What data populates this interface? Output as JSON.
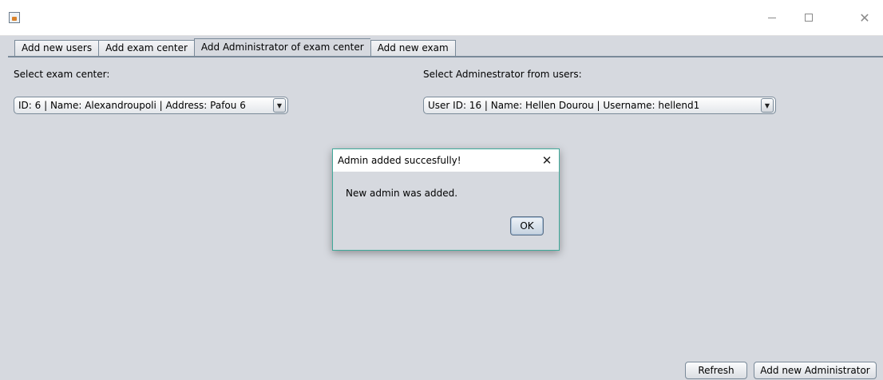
{
  "window": {
    "title": "",
    "minimize_glyph": "—",
    "maximize_glyph": "☐",
    "close_glyph": "✕"
  },
  "tabs": [
    {
      "label": "Add new users",
      "active": false
    },
    {
      "label": "Add exam center",
      "active": false
    },
    {
      "label": "Add Administrator of exam center",
      "active": true
    },
    {
      "label": "Add new exam",
      "active": false
    }
  ],
  "form": {
    "exam_center_label": "Select exam center:",
    "exam_center_selected": "ID: 6 | Name: Alexandroupoli | Address: Pafou 6",
    "admin_label": "Select Adminestrator from users:",
    "admin_selected": "User ID: 16 | Name: Hellen Dourou | Username: hellend1",
    "arrow_glyph": "▼"
  },
  "buttons": {
    "refresh": "Refresh",
    "add_admin": "Add new Administrator"
  },
  "dialog": {
    "title": "Admin added succesfully!",
    "message": "New admin was added.",
    "ok": "OK",
    "close_glyph": "✕"
  },
  "colors": {
    "background": "#d6d9df",
    "dialog_border": "#3fa99a",
    "tab_border": "#7a8a99"
  }
}
